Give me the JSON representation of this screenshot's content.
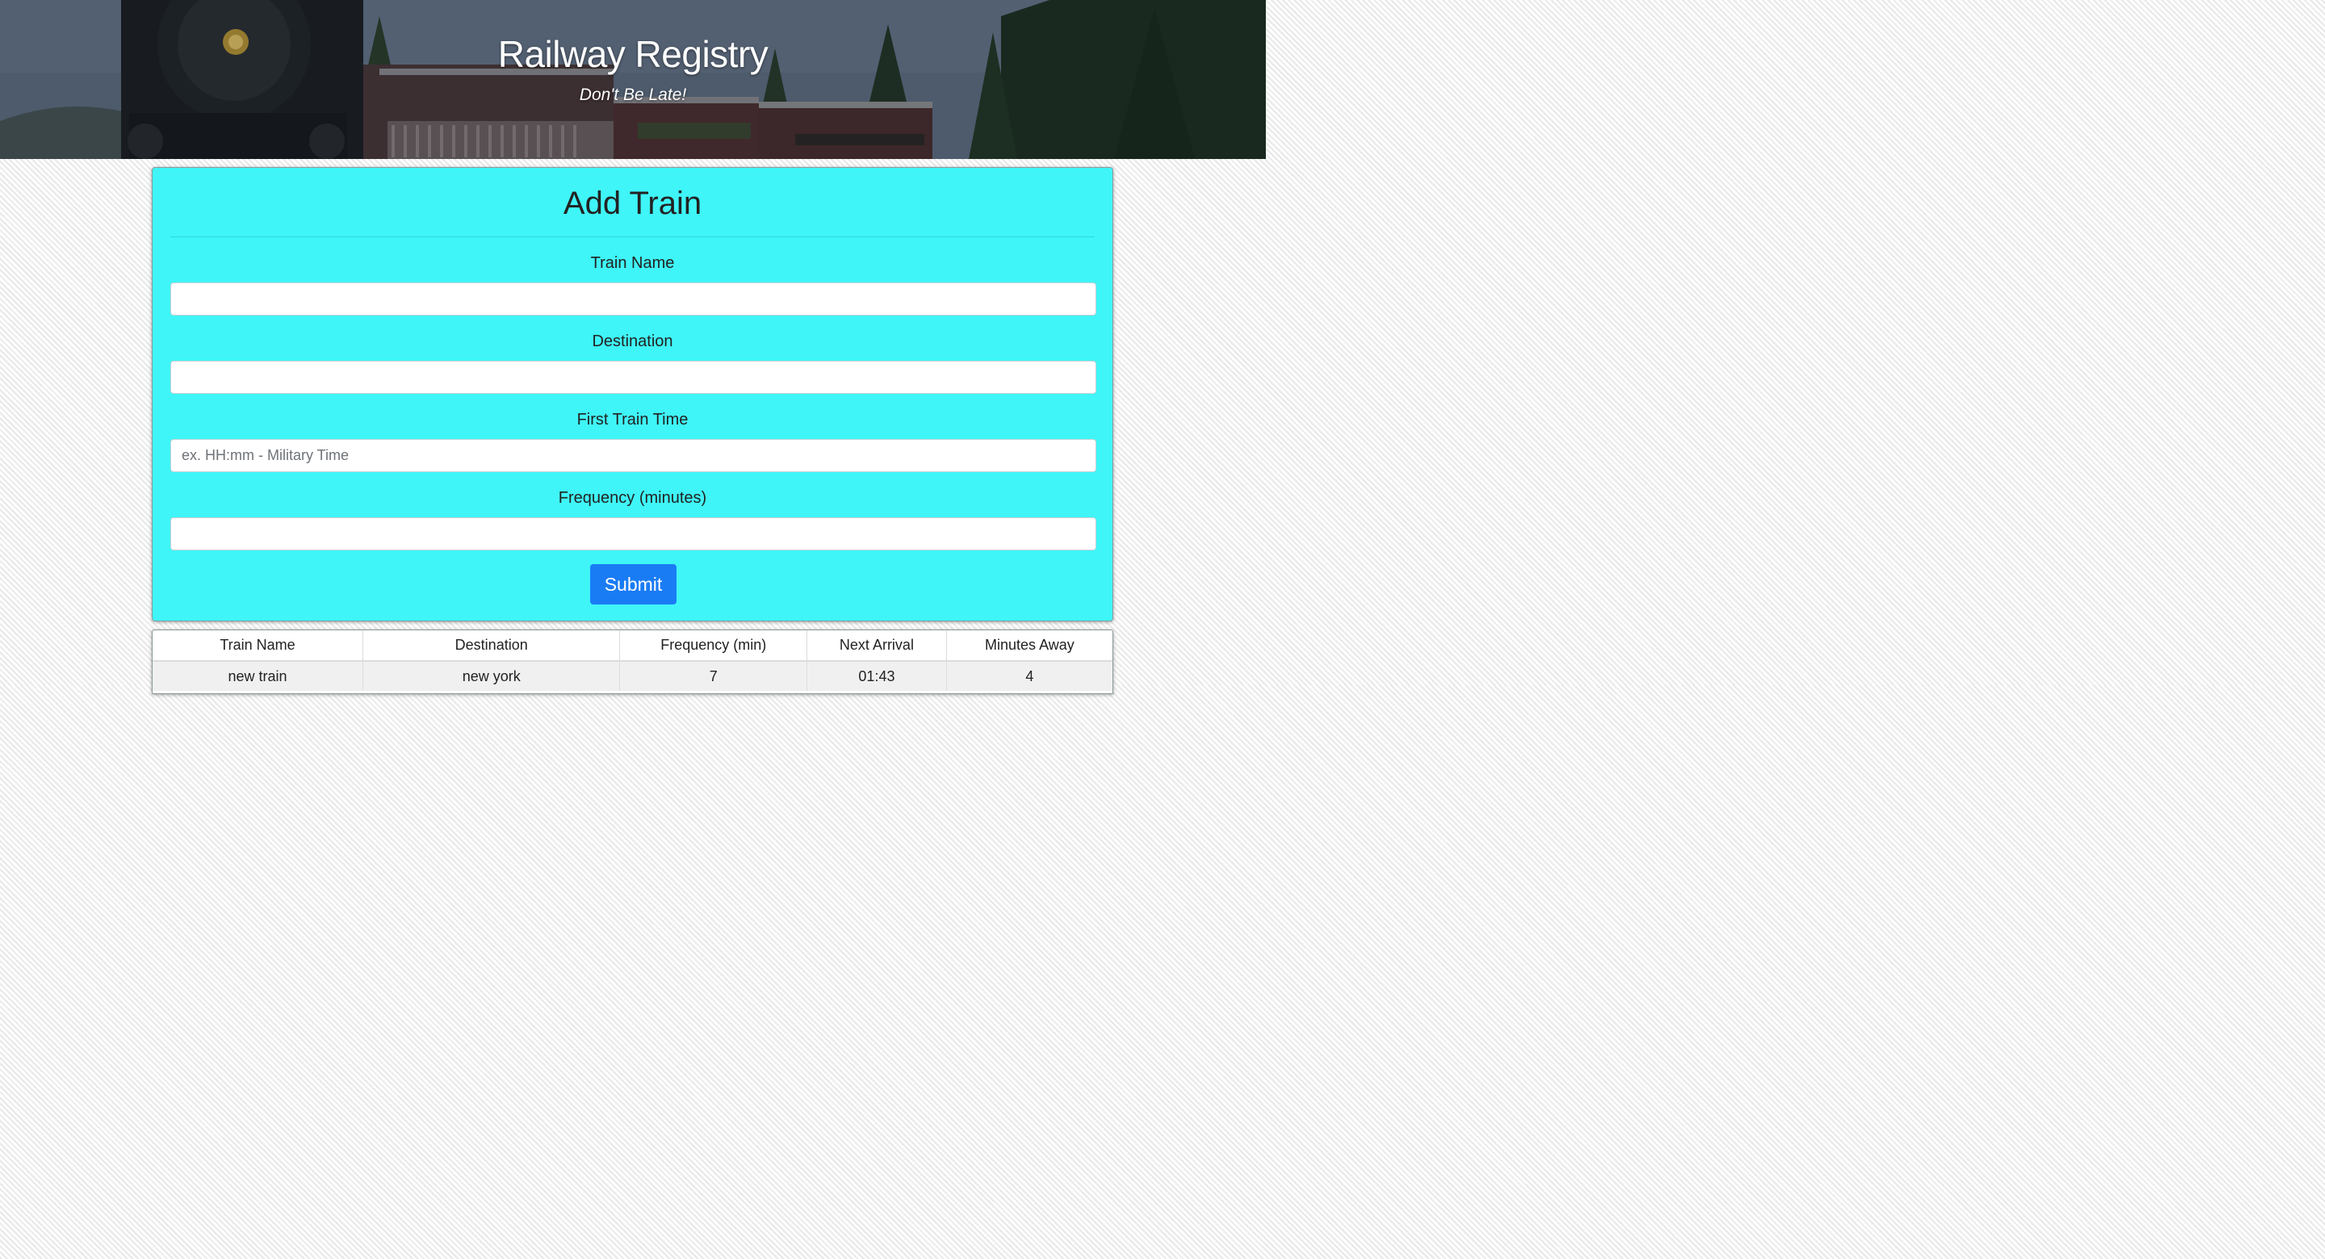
{
  "header": {
    "title": "Railway Registry",
    "subtitle": "Don't Be Late!"
  },
  "form": {
    "title": "Add Train",
    "fields": [
      {
        "label": "Train Name",
        "value": "",
        "placeholder": ""
      },
      {
        "label": "Destination",
        "value": "",
        "placeholder": ""
      },
      {
        "label": "First Train Time",
        "value": "",
        "placeholder": "ex. HH:mm - Military Time"
      },
      {
        "label": "Frequency (minutes)",
        "value": "",
        "placeholder": ""
      }
    ],
    "submit_label": "Submit"
  },
  "table": {
    "columns": [
      "Train Name",
      "Destination",
      "Frequency (min)",
      "Next Arrival",
      "Minutes Away"
    ],
    "rows": [
      [
        "new train",
        "new york",
        "7",
        "01:43",
        "4"
      ]
    ]
  },
  "colors": {
    "card_background": "#3ff5f7",
    "submit_button": "#1a7cf5"
  }
}
